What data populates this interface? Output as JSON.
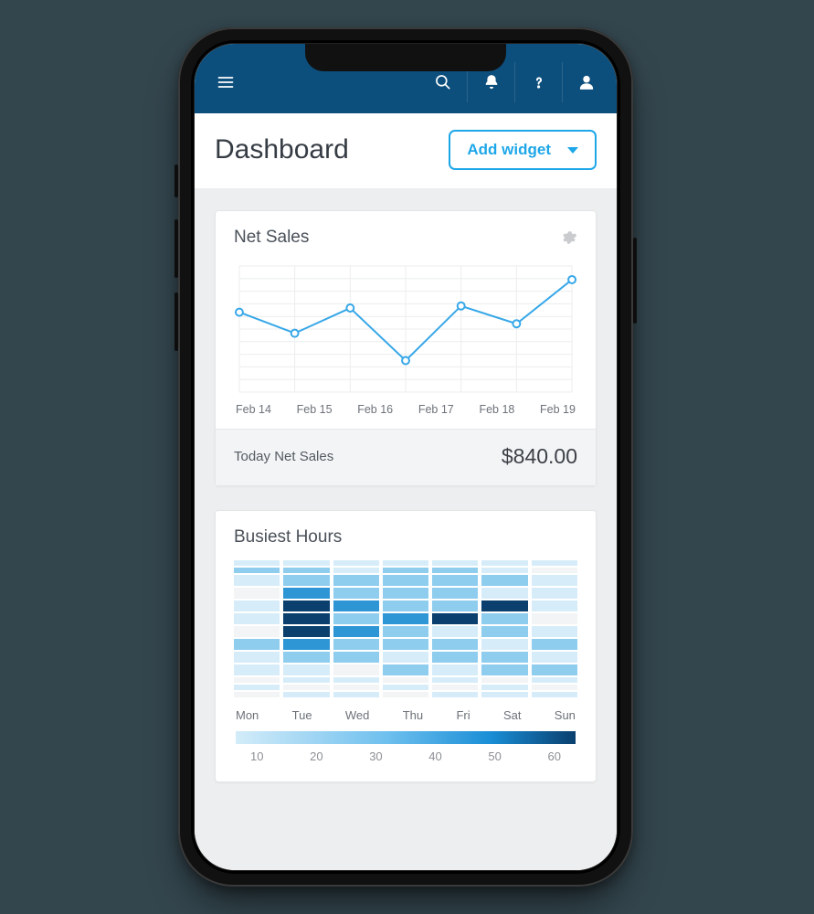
{
  "header": {
    "page_title": "Dashboard",
    "add_widget_label": "Add widget"
  },
  "cards": {
    "net_sales": {
      "title": "Net Sales",
      "summary_label": "Today Net Sales",
      "summary_value": "$840.00",
      "x_labels": [
        "Feb 14",
        "Feb 15",
        "Feb 16",
        "Feb 17",
        "Feb 18",
        "Feb 19"
      ]
    },
    "busiest": {
      "title": "Busiest Hours",
      "days": [
        "Mon",
        "Tue",
        "Wed",
        "Thu",
        "Fri",
        "Sat",
        "Sun"
      ],
      "legend_ticks": [
        "10",
        "20",
        "30",
        "40",
        "50",
        "60"
      ]
    }
  },
  "chart_data": [
    {
      "type": "line",
      "title": "Net Sales",
      "categories": [
        "Feb 14",
        "Feb 15",
        "Feb 16",
        "Feb 17",
        "Feb 18",
        "Feb 19"
      ],
      "unit": "USD",
      "ylim_approx": [
        0,
        1200
      ],
      "values_approx": [
        760,
        560,
        800,
        300,
        820,
        650,
        1070
      ],
      "note": "Y-axis is unlabeled; values are estimates normalized so today ≈ 840 matching the summary. 7 points span 6 date labels (first point slightly left of Feb 14)."
    },
    {
      "type": "heatmap",
      "title": "Busiest Hours",
      "x_categories": [
        "Mon",
        "Tue",
        "Wed",
        "Thu",
        "Fri",
        "Sat",
        "Sun"
      ],
      "rows": 13,
      "legend_range": [
        0,
        70
      ],
      "intensity_0_4": [
        [
          1,
          1,
          1,
          1,
          1,
          1,
          1
        ],
        [
          2,
          2,
          1,
          2,
          2,
          1,
          0
        ],
        [
          1,
          2,
          2,
          2,
          2,
          2,
          1
        ],
        [
          0,
          3,
          2,
          2,
          2,
          1,
          1
        ],
        [
          1,
          4,
          3,
          2,
          2,
          4,
          1
        ],
        [
          1,
          4,
          2,
          3,
          4,
          2,
          0
        ],
        [
          0,
          4,
          3,
          2,
          1,
          2,
          1
        ],
        [
          2,
          3,
          2,
          2,
          2,
          1,
          2
        ],
        [
          1,
          2,
          2,
          1,
          2,
          2,
          1
        ],
        [
          1,
          1,
          0,
          2,
          1,
          2,
          2
        ],
        [
          0,
          1,
          1,
          0,
          1,
          0,
          1
        ],
        [
          1,
          0,
          0,
          1,
          0,
          1,
          0
        ],
        [
          0,
          1,
          1,
          0,
          1,
          1,
          1
        ]
      ],
      "note": "Hour-of-day rows are unlabeled; intensities estimated visually on a 0–4 scale mapped to the blue legend."
    }
  ],
  "colors": {
    "accent": "#1ea7e8",
    "topbar": "#0d4f7c",
    "heat_scale": [
      "#f2f4f5",
      "#d6edf9",
      "#8fcdef",
      "#2f96d6",
      "#0a3f6e"
    ]
  }
}
